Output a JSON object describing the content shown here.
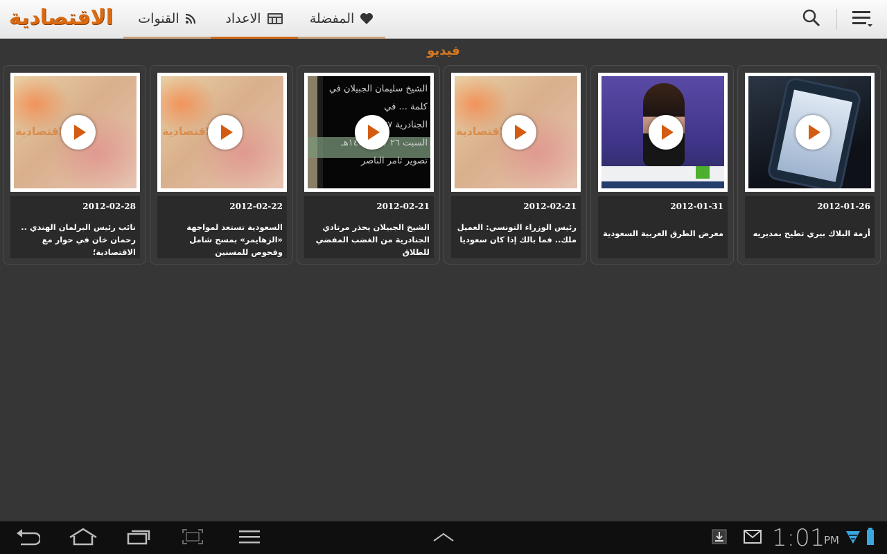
{
  "app": {
    "logo_text": "الاقتصادية"
  },
  "tabs": [
    {
      "label": "المفضلة",
      "icon": "heart-icon"
    },
    {
      "label": "الاعداد",
      "icon": "newspaper-icon",
      "active": true
    },
    {
      "label": "القنوات",
      "icon": "rss-icon"
    }
  ],
  "header_icons": [
    "search-icon",
    "menu-icon"
  ],
  "section_title": "فيديو",
  "videos": [
    {
      "date": "2012-02-28",
      "title": "نائب رئيس البرلمان الهندي .. رحمان خان في حوار مع الاقتصادية؛",
      "watermark": "الاقتصادية"
    },
    {
      "date": "2012-02-22",
      "title": "السعودية تستعد لمواجهة «الزهايمر» بمسح شامل وفحوص للمسنين",
      "watermark": "الاقتصادية"
    },
    {
      "date": "2012-02-21",
      "title": "الشيخ الجبيلان يحذر مرتادي الجنادرية من الغضب المفضي للطلاق",
      "thumb_text": [
        "الشيخ سليمان الجبيلان في",
        "كلمة ... في",
        "الجنادرية ٢٧",
        "السبت ٢٦ / ٣ / ١٤٣٣هـ",
        "تصوير ثامر الناصر"
      ]
    },
    {
      "date": "2012-02-21",
      "title": "رئيس الوزراء التونسي: العميل ملك.. فما بالك إذا كان سعوديا",
      "watermark": "الاقتصادية"
    },
    {
      "date": "2012-01-31",
      "title": "معرض الطرق العربية السعودية"
    },
    {
      "date": "2012-01-26",
      "title": "أزمة البلاك بيري تطيح بمديريه"
    }
  ],
  "system_bar": {
    "time": "1:01",
    "ampm": "PM",
    "nav_icons": [
      "back-icon",
      "home-icon",
      "recent-apps-icon",
      "screenshot-icon",
      "menu-icon",
      "up-chevron-icon"
    ],
    "status_icons": [
      "download-icon",
      "mail-icon",
      "wifi-icon",
      "battery-icon"
    ]
  },
  "colors": {
    "accent": "#d06a1a",
    "background": "#363636",
    "card_meta_bg": "#2a2a2a"
  }
}
